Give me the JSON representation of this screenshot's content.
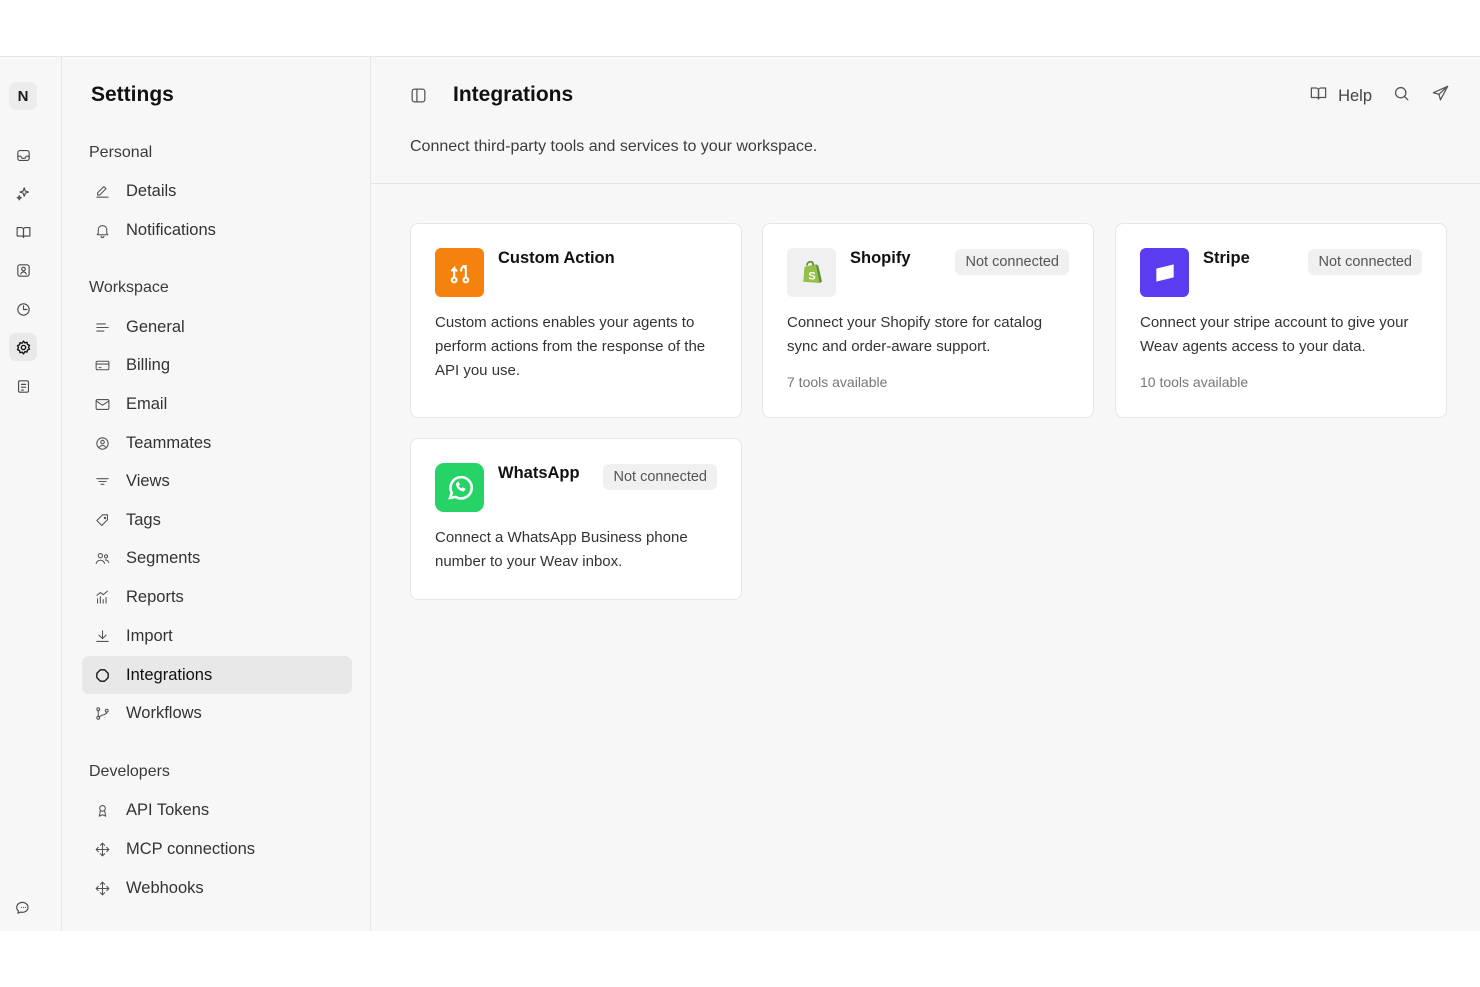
{
  "rail": {
    "avatar": "N",
    "icons": [
      "inbox-icon",
      "sparkles-icon",
      "book-icon",
      "contact-icon",
      "clock-icon",
      "gear-icon",
      "list-icon",
      "chat-icon"
    ]
  },
  "sidebar": {
    "title": "Settings",
    "personal_label": "Personal",
    "personal": [
      {
        "label": "Details",
        "icon": "pencil-icon"
      },
      {
        "label": "Notifications",
        "icon": "bell-icon"
      }
    ],
    "workspace_label": "Workspace",
    "workspace": [
      {
        "label": "General",
        "icon": "lines-icon"
      },
      {
        "label": "Billing",
        "icon": "card-icon"
      },
      {
        "label": "Email",
        "icon": "mail-icon"
      },
      {
        "label": "Teammates",
        "icon": "user-circle-icon"
      },
      {
        "label": "Views",
        "icon": "filter-icon"
      },
      {
        "label": "Tags",
        "icon": "tag-icon"
      },
      {
        "label": "Segments",
        "icon": "users-icon"
      },
      {
        "label": "Reports",
        "icon": "chart-icon"
      },
      {
        "label": "Import",
        "icon": "download-icon"
      },
      {
        "label": "Integrations",
        "icon": "puzzle-icon",
        "active": true
      },
      {
        "label": "Workflows",
        "icon": "workflow-icon"
      }
    ],
    "developers_label": "Developers",
    "developers": [
      {
        "label": "API Tokens",
        "icon": "badge-icon"
      },
      {
        "label": "MCP connections",
        "icon": "move-icon"
      },
      {
        "label": "Webhooks",
        "icon": "move-icon"
      }
    ]
  },
  "header": {
    "title": "Integrations",
    "description": "Connect third-party tools and services to your workspace.",
    "help_label": "Help"
  },
  "cards": [
    {
      "name": "Custom Action",
      "status": "",
      "desc": "Custom actions enables your agents to perform actions from the response of the API you use.",
      "tools": "",
      "color": "#f5820d"
    },
    {
      "name": "Shopify",
      "status": "Not connected",
      "desc": "Connect your Shopify store for catalog sync and order-aware support.",
      "tools": "7 tools available",
      "color": "#f0f0f0"
    },
    {
      "name": "Stripe",
      "status": "Not connected",
      "desc": "Connect your stripe account to give your Weav agents access to your data.",
      "tools": "10 tools available",
      "color": "#5b3cf0"
    },
    {
      "name": "WhatsApp",
      "status": "Not connected",
      "desc": "Connect a WhatsApp Business phone number to your Weav inbox.",
      "tools": "",
      "color": "#25d366"
    }
  ]
}
